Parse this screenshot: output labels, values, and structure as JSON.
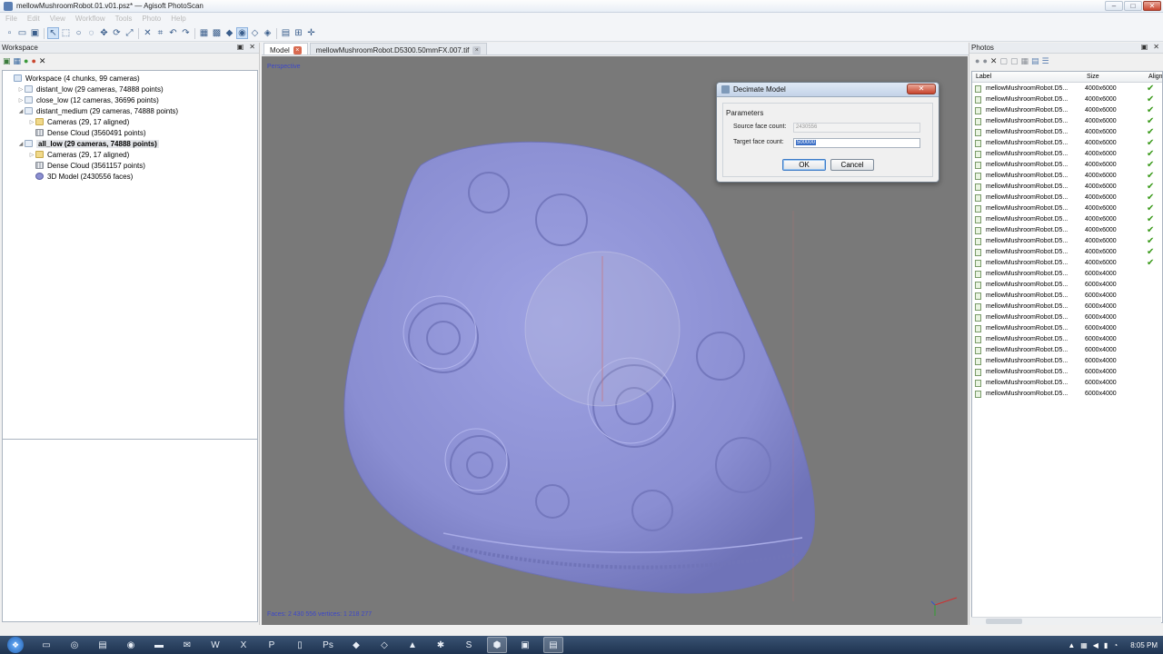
{
  "window": {
    "title": "mellowMushroomRobot.01.v01.psz* — Agisoft PhotoScan",
    "controls": [
      "–",
      "□",
      "✕"
    ]
  },
  "menu": [
    "File",
    "Edit",
    "View",
    "Workflow",
    "Tools",
    "Photo",
    "Help"
  ],
  "workspace": {
    "title": "Workspace",
    "tree": [
      {
        "label": "Workspace (4 chunks, 99 cameras)",
        "level": 0,
        "icon": "ws"
      },
      {
        "label": "distant_low (29 cameras, 74888 points)",
        "level": 1,
        "icon": "chunk",
        "exp": "▷"
      },
      {
        "label": "close_low (12 cameras, 36696 points)",
        "level": 1,
        "icon": "chunk",
        "exp": "▷"
      },
      {
        "label": "distant_medium (29 cameras, 74888 points)",
        "level": 1,
        "icon": "chunk",
        "exp": "◢"
      },
      {
        "label": "Cameras (29, 17 aligned)",
        "level": 2,
        "icon": "folder",
        "exp": "▷"
      },
      {
        "label": "Dense Cloud (3560491 points)",
        "level": 2,
        "icon": "grid",
        "exp": ""
      },
      {
        "label": "all_low (29 cameras, 74888 points)",
        "level": 1,
        "icon": "chunk",
        "exp": "◢",
        "active": true
      },
      {
        "label": "Cameras (29, 17 aligned)",
        "level": 2,
        "icon": "folder",
        "exp": "▷"
      },
      {
        "label": "Dense Cloud (3561157 points)",
        "level": 2,
        "icon": "grid",
        "exp": ""
      },
      {
        "label": "3D Model (2430556 faces)",
        "level": 2,
        "icon": "model",
        "exp": ""
      }
    ]
  },
  "model": {
    "tabs": [
      {
        "label": "Model",
        "active": true
      },
      {
        "label": "mellowMushroomRobot.D5300.50mmFX.007.tif",
        "active": false
      }
    ],
    "view_label": "Perspective",
    "stats": "Faces: 2 430 556 vertices: 1 218 277"
  },
  "dialog": {
    "title": "Decimate Model",
    "group": "Parameters",
    "source_label": "Source face count:",
    "source_value": "2430556",
    "target_label": "Target face count:",
    "target_value": "500000",
    "ok": "OK",
    "cancel": "Cancel",
    "close": "✕"
  },
  "photos": {
    "title": "Photos",
    "columns": {
      "label": "Label",
      "size": "Size",
      "align": "Align"
    },
    "rows": [
      {
        "name": "mellowMushroomRobot.D5...",
        "size": "4000x6000"
      },
      {
        "name": "mellowMushroomRobot.D5...",
        "size": "4000x6000"
      },
      {
        "name": "mellowMushroomRobot.D5...",
        "size": "4000x6000"
      },
      {
        "name": "mellowMushroomRobot.D5...",
        "size": "4000x6000"
      },
      {
        "name": "mellowMushroomRobot.D5...",
        "size": "4000x6000"
      },
      {
        "name": "mellowMushroomRobot.D5...",
        "size": "4000x6000"
      },
      {
        "name": "mellowMushroomRobot.D5...",
        "size": "4000x6000"
      },
      {
        "name": "mellowMushroomRobot.D5...",
        "size": "4000x6000"
      },
      {
        "name": "mellowMushroomRobot.D5...",
        "size": "4000x6000"
      },
      {
        "name": "mellowMushroomRobot.D5...",
        "size": "4000x6000"
      },
      {
        "name": "mellowMushroomRobot.D5...",
        "size": "4000x6000"
      },
      {
        "name": "mellowMushroomRobot.D5...",
        "size": "4000x6000"
      },
      {
        "name": "mellowMushroomRobot.D5...",
        "size": "4000x6000"
      },
      {
        "name": "mellowMushroomRobot.D5...",
        "size": "4000x6000"
      },
      {
        "name": "mellowMushroomRobot.D5...",
        "size": "4000x6000"
      },
      {
        "name": "mellowMushroomRobot.D5...",
        "size": "4000x6000"
      },
      {
        "name": "mellowMushroomRobot.D5...",
        "size": "4000x6000"
      },
      {
        "name": "mellowMushroomRobot.D5...",
        "size": "6000x4000"
      },
      {
        "name": "mellowMushroomRobot.D5...",
        "size": "6000x4000"
      },
      {
        "name": "mellowMushroomRobot.D5...",
        "size": "6000x4000"
      },
      {
        "name": "mellowMushroomRobot.D5...",
        "size": "6000x4000"
      },
      {
        "name": "mellowMushroomRobot.D5...",
        "size": "6000x4000"
      },
      {
        "name": "mellowMushroomRobot.D5...",
        "size": "6000x4000"
      },
      {
        "name": "mellowMushroomRobot.D5...",
        "size": "6000x4000"
      },
      {
        "name": "mellowMushroomRobot.D5...",
        "size": "6000x4000"
      },
      {
        "name": "mellowMushroomRobot.D5...",
        "size": "6000x4000"
      },
      {
        "name": "mellowMushroomRobot.D5...",
        "size": "6000x4000"
      },
      {
        "name": "mellowMushroomRobot.D5...",
        "size": "6000x4000"
      },
      {
        "name": "mellowMushroomRobot.D5...",
        "size": "6000x4000"
      }
    ],
    "aligned_count": 17
  },
  "taskbar": {
    "clock": "8:05 PM"
  },
  "colors": {
    "mesh": "#8f93d6",
    "viewport": "#797979",
    "overlay_text": "#3d48c8",
    "check": "#3a9a1a"
  }
}
